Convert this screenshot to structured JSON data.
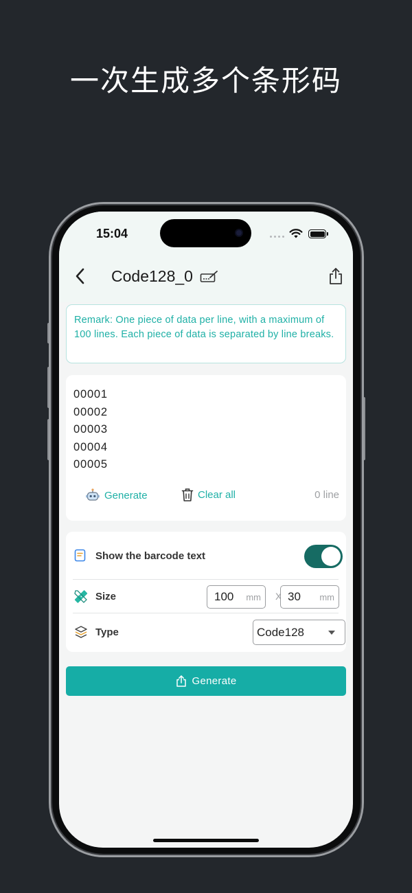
{
  "headline": "一次生成多个条形码",
  "status": {
    "time": "15:04"
  },
  "nav": {
    "title": "Code128_0"
  },
  "remark": "Remark: One piece of data per line, with a maximum of 100 lines. Each piece of data is separated by line breaks.",
  "data_input": {
    "lines": [
      "00001",
      "00002",
      "00003",
      "00004",
      "00005"
    ]
  },
  "actions": {
    "generate_label": "Generate",
    "clear_label": "Clear all",
    "line_count": "0 line"
  },
  "settings": {
    "show_text_label": "Show the barcode text",
    "show_text_on": true,
    "size_label": "Size",
    "width": "100",
    "height": "30",
    "unit": "mm",
    "separator": "X",
    "type_label": "Type",
    "type_value": "Code128"
  },
  "generate_button": "Generate",
  "colors": {
    "accent": "#1fb0a6",
    "toggle": "#166b63",
    "button": "#16ada6",
    "background": "#23272c"
  }
}
